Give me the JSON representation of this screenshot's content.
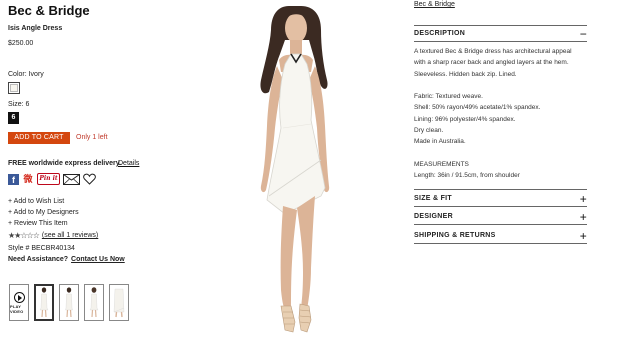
{
  "product": {
    "brand": "Bec & Bridge",
    "name": "Isis Angle Dress",
    "price": "$250.00",
    "color_label": "Color: Ivory",
    "size_label": "Size: 6",
    "selected_size": "6",
    "add_to_cart": "ADD TO CART",
    "stock_note": "Only 1 left",
    "shipping_text": "FREE worldwide express delivery.",
    "shipping_details": "Details",
    "actions": [
      "+ Add to Wish List",
      "+ Add to My Designers",
      "+ Review This Item"
    ],
    "rating": {
      "stars": 2,
      "max": 5,
      "reviews_link": "(see all 1 reviews)"
    },
    "style_number": "Style # BECBR40134",
    "assistance": {
      "label": "Need Assistance?",
      "link": "Contact Us Now"
    },
    "video_label": "PLAY VIDEO",
    "accent_color": "#d4470e"
  },
  "social": {
    "icons": [
      "facebook-icon",
      "weibo-icon",
      "pinterest-icon",
      "email-icon",
      "heart-icon"
    ],
    "facebook": "f",
    "weibo": "微",
    "pinterest": "Pin it"
  },
  "details_panel": {
    "brand_link": "Bec & Bridge",
    "description": {
      "title": "DESCRIPTION",
      "toggle": "−",
      "lines": [
        "A textured Bec & Bridge dress has architectural appeal",
        "with a sharp racer back and angled layers at the hem.",
        "Sleeveless. Hidden back zip. Lined.",
        "",
        "Fabric: Textured weave.",
        "Shell: 50% rayon/49% acetate/1% spandex.",
        "Lining: 96% polyester/4% spandex.",
        "Dry clean.",
        "Made in Australia.",
        "",
        "MEASUREMENTS",
        "Length: 36in / 91.5cm, from shoulder"
      ]
    },
    "sections": [
      {
        "title": "SIZE & FIT",
        "toggle": "+"
      },
      {
        "title": "DESIGNER",
        "toggle": "+"
      },
      {
        "title": "SHIPPING & RETURNS",
        "toggle": "+"
      }
    ]
  }
}
